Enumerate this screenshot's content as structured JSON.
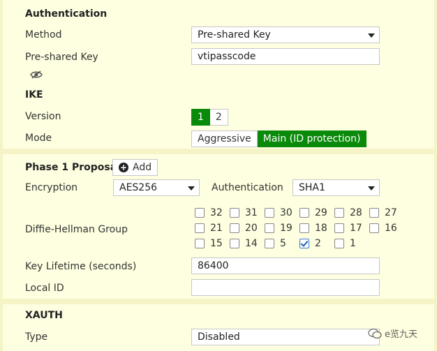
{
  "auth": {
    "title": "Authentication",
    "method_label": "Method",
    "method_value": "Pre-shared Key",
    "psk_label": "Pre-shared Key",
    "psk_value": "vtipasscode"
  },
  "ike": {
    "title": "IKE",
    "version_label": "Version",
    "versions": [
      "1",
      "2"
    ],
    "version_selected": "1",
    "mode_label": "Mode",
    "modes": [
      "Aggressive",
      "Main (ID protection)"
    ],
    "mode_selected": "Main (ID protection)"
  },
  "phase1": {
    "title": "Phase 1 Proposal",
    "add_label": "Add",
    "encryption_label": "Encryption",
    "encryption_value": "AES256",
    "authentication_label": "Authentication",
    "authentication_value": "SHA1",
    "dh_label": "Diffie-Hellman Group",
    "dh_groups": [
      {
        "label": "32",
        "checked": false
      },
      {
        "label": "31",
        "checked": false
      },
      {
        "label": "30",
        "checked": false
      },
      {
        "label": "29",
        "checked": false
      },
      {
        "label": "28",
        "checked": false
      },
      {
        "label": "27",
        "checked": false
      },
      {
        "label": "21",
        "checked": false
      },
      {
        "label": "20",
        "checked": false
      },
      {
        "label": "19",
        "checked": false
      },
      {
        "label": "18",
        "checked": false
      },
      {
        "label": "17",
        "checked": false
      },
      {
        "label": "16",
        "checked": false
      },
      {
        "label": "15",
        "checked": false
      },
      {
        "label": "14",
        "checked": false
      },
      {
        "label": "5",
        "checked": false
      },
      {
        "label": "2",
        "checked": true
      },
      {
        "label": "1",
        "checked": false
      }
    ],
    "key_lifetime_label": "Key Lifetime (seconds)",
    "key_lifetime_value": "86400",
    "local_id_label": "Local ID",
    "local_id_value": ""
  },
  "xauth": {
    "title": "XAUTH",
    "type_label": "Type",
    "type_value": "Disabled"
  },
  "watermark": "e览九天",
  "colors": {
    "background": "#f4f4c6",
    "panel": "#fefee0",
    "active_green": "#0a8a0a"
  },
  "icons": {
    "psk_toggle": "eye-slash-icon",
    "add": "plus-circle-icon",
    "watermark": "wechat-icon"
  }
}
